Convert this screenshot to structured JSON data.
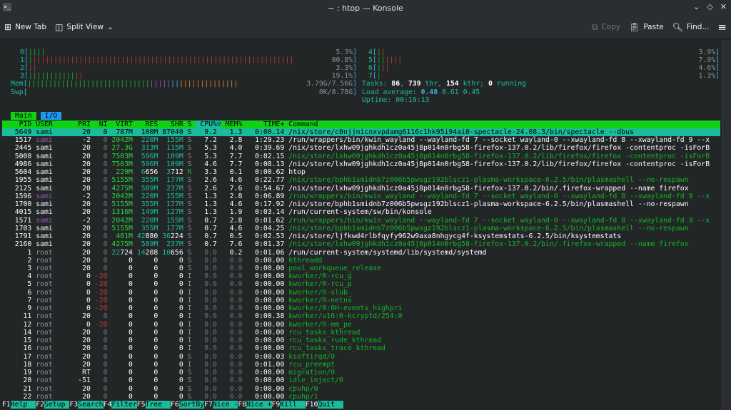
{
  "window": {
    "title": "~ : htop — Konsole",
    "app_icon": "terminal-icon",
    "controls": [
      "minimize-icon",
      "maximize-icon",
      "close-icon"
    ]
  },
  "toolbar": {
    "new_tab": "New Tab",
    "split_view": "Split View",
    "copy": "Copy",
    "paste": "Paste",
    "find": "Find..."
  },
  "meters": {
    "cpus": [
      {
        "id": "0",
        "percent": "5.3%",
        "normal": 5.3,
        "kernel": 0
      },
      {
        "id": "1",
        "percent": "90.8%",
        "normal": 1.5,
        "kernel": 89.3
      },
      {
        "id": "2",
        "percent": "3.3%",
        "normal": 0,
        "kernel": 3.3
      },
      {
        "id": "3",
        "percent": "19.1%",
        "normal": 16.5,
        "kernel": 2.6
      },
      {
        "id": "4",
        "percent": "3.9%",
        "normal": 2,
        "kernel": 1.9
      },
      {
        "id": "5",
        "percent": "7.9%",
        "normal": 3,
        "kernel": 4.9
      },
      {
        "id": "6",
        "percent": "4.6%",
        "normal": 1.5,
        "kernel": 3.1
      },
      {
        "id": "7",
        "percent": "1.3%",
        "normal": 1.3,
        "kernel": 0
      }
    ],
    "mem": {
      "label": "Mem",
      "value": "3.79G/7.56G",
      "used": 44,
      "buffers": 8,
      "shared": 3,
      "cache": 21
    },
    "swp": {
      "label": "Swp",
      "value": "0K/8.78G",
      "used": 0
    },
    "tasks": {
      "label": "Tasks: ",
      "tasks": "86",
      "thr": "739",
      "kthr": "154",
      "running": "0",
      "sep1": ", ",
      "thr_label": " thr, ",
      "kthr_label": " kthr; ",
      "running_label": " running"
    },
    "load": {
      "label": "Load average: ",
      "one": "0.48",
      "five": "0.61",
      "fifteen": "0.45"
    },
    "uptime": {
      "label": "Uptime: ",
      "value": "00:19:13"
    }
  },
  "tabs": [
    "Main",
    "I/O"
  ],
  "columns": [
    "PID",
    "USER",
    "PRI",
    "NI",
    "VIRT",
    "RES",
    "SHR",
    "S",
    "CPU%",
    "MEM%",
    "TIME+",
    "Command"
  ],
  "sort_indicator": "▽",
  "processes": [
    {
      "pid": "5649",
      "user": "sami",
      "pri": "20",
      "ni": "0",
      "virt": "787M",
      "res": "100M",
      "shr": "87040",
      "s": "S",
      "cpu": "9.2",
      "mem": "1.3",
      "time": "0:00.14",
      "cmd": "/nix/store/c0njjnicnxvpdamg6116c1hk95i94ai0-spectacle-24.08.3/bin/spectacle --dbus",
      "selected": true
    },
    {
      "pid": "1517",
      "user": "sami",
      "pri": "-2",
      "ni": "0",
      "virt": "2042M",
      "res": "220M",
      "shr": "155M",
      "s": "S",
      "cpu": "7.2",
      "mem": "2.8",
      "time": "1:29.23",
      "cmd": "/run/wrappers/bin/kwin_wayland --wayland-fd 7 --socket wayland-0 --xwayland-fd 8 --xwayland-fd 9 --x"
    },
    {
      "pid": "2445",
      "user": "sami",
      "pri": "20",
      "ni": "0",
      "virt": "27.3G",
      "res": "313M",
      "shr": "115M",
      "s": "S",
      "cpu": "5.3",
      "mem": "4.0",
      "time": "0:39.69",
      "cmd": "/nix/store/lxhw09jghkdh1cz0a45j8p014n0rbg58-firefox-137.0.2/lib/firefox/firefox -contentproc -isForB"
    },
    {
      "pid": "5008",
      "user": "sami",
      "pri": "20",
      "ni": "0",
      "virt": "7503M",
      "res": "596M",
      "shr": "109M",
      "s": "S",
      "cpu": "5.3",
      "mem": "7.7",
      "time": "0:02.15",
      "cmd": "/nix/store/lxhw09jghkdh1cz0a45j8p014n0rbg58-firefox-137.0.2/lib/firefox/firefox -contentproc -isForB",
      "thread": true
    },
    {
      "pid": "4986",
      "user": "sami",
      "pri": "20",
      "ni": "0",
      "virt": "7503M",
      "res": "596M",
      "shr": "109M",
      "s": "S",
      "cpu": "4.6",
      "mem": "7.7",
      "time": "0:08.13",
      "cmd": "/nix/store/lxhw09jghkdh1cz0a45j8p014n0rbg58-firefox-137.0.2/lib/firefox/firefox -contentproc -isForB"
    },
    {
      "pid": "5604",
      "user": "sami",
      "pri": "20",
      "ni": "0",
      "virt": "229M",
      "res": "6656",
      "shr": "3712",
      "s": "R",
      "cpu": "3.3",
      "mem": "0.1",
      "time": "0:00.62",
      "cmd": "htop"
    },
    {
      "pid": "1955",
      "user": "sami",
      "pri": "20",
      "ni": "0",
      "virt": "5155M",
      "res": "355M",
      "shr": "177M",
      "s": "S",
      "cpu": "2.6",
      "mem": "4.6",
      "time": "0:22.77",
      "cmd": "/nix/store/bphb1smidnb7z006b5pwsgz192blscz1-plasma-workspace-6.2.5/bin/plasmashell --no-respawn",
      "thread": true
    },
    {
      "pid": "2125",
      "user": "sami",
      "pri": "20",
      "ni": "0",
      "virt": "4275M",
      "res": "589M",
      "shr": "237M",
      "s": "S",
      "cpu": "2.6",
      "mem": "7.6",
      "time": "0:54.67",
      "cmd": "/nix/store/lxhw09jghkdh1cz0a45j8p014n0rbg58-firefox-137.0.2/bin/.firefox-wrapped --name firefox"
    },
    {
      "pid": "1596",
      "user": "sami",
      "pri": "-2",
      "ni": "0",
      "virt": "2042M",
      "res": "220M",
      "shr": "155M",
      "s": "S",
      "cpu": "1.3",
      "mem": "2.8",
      "time": "0:06.89",
      "cmd": "/run/wrappers/bin/kwin_wayland --wayland-fd 7 --socket wayland-0 --xwayland-fd 8 --xwayland-fd 9 --x",
      "thread": true
    },
    {
      "pid": "1700",
      "user": "sami",
      "pri": "20",
      "ni": "0",
      "virt": "5155M",
      "res": "355M",
      "shr": "177M",
      "s": "S",
      "cpu": "1.3",
      "mem": "4.6",
      "time": "0:17.92",
      "cmd": "/nix/store/bphb1smidnb7z006b5pwsgz192blscz1-plasma-workspace-6.2.5/bin/plasmashell --no-respawn"
    },
    {
      "pid": "4015",
      "user": "sami",
      "pri": "20",
      "ni": "0",
      "virt": "1316M",
      "res": "149M",
      "shr": "127M",
      "s": "S",
      "cpu": "1.3",
      "mem": "1.9",
      "time": "0:03.14",
      "cmd": "/run/current-system/sw/bin/konsole"
    },
    {
      "pid": "1571",
      "user": "sami",
      "pri": "-2",
      "ni": "0",
      "virt": "2042M",
      "res": "220M",
      "shr": "155M",
      "s": "S",
      "cpu": "0.7",
      "mem": "2.8",
      "time": "0:01.62",
      "cmd": "/run/wrappers/bin/kwin_wayland --wayland-fd 7 --socket wayland-0 --xwayland-fd 8 --xwayland-fd 9 --x",
      "thread": true
    },
    {
      "pid": "1703",
      "user": "sami",
      "pri": "20",
      "ni": "0",
      "virt": "5155M",
      "res": "355M",
      "shr": "177M",
      "s": "S",
      "cpu": "0.7",
      "mem": "4.6",
      "time": "0:04.25",
      "cmd": "/nix/store/bphb1smidnb7z006b5pwsgz192blscz1-plasma-workspace-6.2.5/bin/plasmashell --no-respawn",
      "thread": true
    },
    {
      "pid": "1791",
      "user": "sami",
      "pri": "20",
      "ni": "0",
      "virt": "481M",
      "res": "42880",
      "shr": "36224",
      "s": "S",
      "cpu": "0.7",
      "mem": "0.5",
      "time": "0:02.53",
      "cmd": "/nix/store/ljfkwd4rlbfqyfy962w9axa8nhgycg4f-ksystemstats-6.2.5/bin/ksystemstats"
    },
    {
      "pid": "2160",
      "user": "sami",
      "pri": "20",
      "ni": "0",
      "virt": "4275M",
      "res": "589M",
      "shr": "237M",
      "s": "S",
      "cpu": "0.7",
      "mem": "7.6",
      "time": "0:01.37",
      "cmd": "/nix/store/lxhw09jghkdh1cz0a45j8p014n0rbg58-firefox-137.0.2/bin/.firefox-wrapped --name firefox",
      "thread": true
    },
    {
      "pid": "1",
      "user": "root",
      "pri": "20",
      "ni": "0",
      "virt": "22724",
      "res": "14208",
      "shr": "10656",
      "s": "S",
      "cpu": "0.0",
      "mem": "0.2",
      "time": "0:01.06",
      "cmd": "/run/current-system/systemd/lib/systemd/systemd"
    },
    {
      "pid": "2",
      "user": "root",
      "pri": "20",
      "ni": "0",
      "virt": "0",
      "res": "0",
      "shr": "0",
      "s": "S",
      "cpu": "0.0",
      "mem": "0.0",
      "time": "0:00.00",
      "cmd": "kthreadd",
      "thread": true
    },
    {
      "pid": "3",
      "user": "root",
      "pri": "20",
      "ni": "0",
      "virt": "0",
      "res": "0",
      "shr": "0",
      "s": "S",
      "cpu": "0.0",
      "mem": "0.0",
      "time": "0:00.00",
      "cmd": "pool_workqueue_release",
      "thread": true
    },
    {
      "pid": "4",
      "user": "root",
      "pri": "0",
      "ni": "-20",
      "virt": "0",
      "res": "0",
      "shr": "0",
      "s": "I",
      "cpu": "0.0",
      "mem": "0.0",
      "time": "0:00.00",
      "cmd": "kworker/R-rcu_g",
      "thread": true
    },
    {
      "pid": "5",
      "user": "root",
      "pri": "0",
      "ni": "-20",
      "virt": "0",
      "res": "0",
      "shr": "0",
      "s": "I",
      "cpu": "0.0",
      "mem": "0.0",
      "time": "0:00.00",
      "cmd": "kworker/R-rcu_p",
      "thread": true
    },
    {
      "pid": "6",
      "user": "root",
      "pri": "0",
      "ni": "-20",
      "virt": "0",
      "res": "0",
      "shr": "0",
      "s": "I",
      "cpu": "0.0",
      "mem": "0.0",
      "time": "0:00.00",
      "cmd": "kworker/R-slub_",
      "thread": true
    },
    {
      "pid": "7",
      "user": "root",
      "pri": "0",
      "ni": "-20",
      "virt": "0",
      "res": "0",
      "shr": "0",
      "s": "I",
      "cpu": "0.0",
      "mem": "0.0",
      "time": "0:00.00",
      "cmd": "kworker/R-netns",
      "thread": true
    },
    {
      "pid": "9",
      "user": "root",
      "pri": "0",
      "ni": "-20",
      "virt": "0",
      "res": "0",
      "shr": "0",
      "s": "I",
      "cpu": "0.0",
      "mem": "0.0",
      "time": "0:00.00",
      "cmd": "kworker/0:0H-events_highpri",
      "thread": true
    },
    {
      "pid": "11",
      "user": "root",
      "pri": "20",
      "ni": "0",
      "virt": "0",
      "res": "0",
      "shr": "0",
      "s": "I",
      "cpu": "0.0",
      "mem": "0.0",
      "time": "0:00.38",
      "cmd": "kworker/u16:0-kcryptd/254:0",
      "thread": true
    },
    {
      "pid": "12",
      "user": "root",
      "pri": "0",
      "ni": "-20",
      "virt": "0",
      "res": "0",
      "shr": "0",
      "s": "I",
      "cpu": "0.0",
      "mem": "0.0",
      "time": "0:00.00",
      "cmd": "kworker/R-mm_pe",
      "thread": true
    },
    {
      "pid": "14",
      "user": "root",
      "pri": "20",
      "ni": "0",
      "virt": "0",
      "res": "0",
      "shr": "0",
      "s": "I",
      "cpu": "0.0",
      "mem": "0.0",
      "time": "0:00.00",
      "cmd": "rcu_tasks_kthread",
      "thread": true
    },
    {
      "pid": "15",
      "user": "root",
      "pri": "20",
      "ni": "0",
      "virt": "0",
      "res": "0",
      "shr": "0",
      "s": "I",
      "cpu": "0.0",
      "mem": "0.0",
      "time": "0:00.00",
      "cmd": "rcu_tasks_rude_kthread",
      "thread": true
    },
    {
      "pid": "16",
      "user": "root",
      "pri": "20",
      "ni": "0",
      "virt": "0",
      "res": "0",
      "shr": "0",
      "s": "I",
      "cpu": "0.0",
      "mem": "0.0",
      "time": "0:00.00",
      "cmd": "rcu_tasks_trace_kthread",
      "thread": true
    },
    {
      "pid": "17",
      "user": "root",
      "pri": "20",
      "ni": "0",
      "virt": "0",
      "res": "0",
      "shr": "0",
      "s": "S",
      "cpu": "0.0",
      "mem": "0.0",
      "time": "0:00.03",
      "cmd": "ksoftirqd/0",
      "thread": true
    },
    {
      "pid": "18",
      "user": "root",
      "pri": "20",
      "ni": "0",
      "virt": "0",
      "res": "0",
      "shr": "0",
      "s": "I",
      "cpu": "0.0",
      "mem": "0.0",
      "time": "0:01.00",
      "cmd": "rcu_preempt",
      "thread": true
    },
    {
      "pid": "19",
      "user": "root",
      "pri": "RT",
      "ni": "0",
      "virt": "0",
      "res": "0",
      "shr": "0",
      "s": "S",
      "cpu": "0.0",
      "mem": "0.0",
      "time": "0:00.00",
      "cmd": "migration/0",
      "thread": true
    },
    {
      "pid": "20",
      "user": "root",
      "pri": "-51",
      "ni": "0",
      "virt": "0",
      "res": "0",
      "shr": "0",
      "s": "S",
      "cpu": "0.0",
      "mem": "0.0",
      "time": "0:00.00",
      "cmd": "idle_inject/0",
      "thread": true
    },
    {
      "pid": "21",
      "user": "root",
      "pri": "20",
      "ni": "0",
      "virt": "0",
      "res": "0",
      "shr": "0",
      "s": "S",
      "cpu": "0.0",
      "mem": "0.0",
      "time": "0:00.00",
      "cmd": "cpuhp/0",
      "thread": true
    },
    {
      "pid": "22",
      "user": "root",
      "pri": "20",
      "ni": "0",
      "virt": "0",
      "res": "0",
      "shr": "0",
      "s": "S",
      "cpu": "0.0",
      "mem": "0.0",
      "time": "0:00.00",
      "cmd": "cpuhp/1",
      "thread": true
    }
  ],
  "function_bar": [
    {
      "key": "F1",
      "label": "Help  "
    },
    {
      "key": "F2",
      "label": "Setup "
    },
    {
      "key": "F3",
      "label": "Search"
    },
    {
      "key": "F4",
      "label": "Filter"
    },
    {
      "key": "F5",
      "label": "Tree  "
    },
    {
      "key": "F6",
      "label": "SortBy"
    },
    {
      "key": "F7",
      "label": "Nice -"
    },
    {
      "key": "F8",
      "label": "Nice +"
    },
    {
      "key": "F9",
      "label": "Kill  "
    },
    {
      "key": "F10",
      "label": "Quit  "
    }
  ],
  "colors": {
    "header_bg": "#11d116",
    "selection_bg": "#1abc9c",
    "io_tab_bg": "#1d99f3",
    "terminal_bg": "#232627"
  }
}
